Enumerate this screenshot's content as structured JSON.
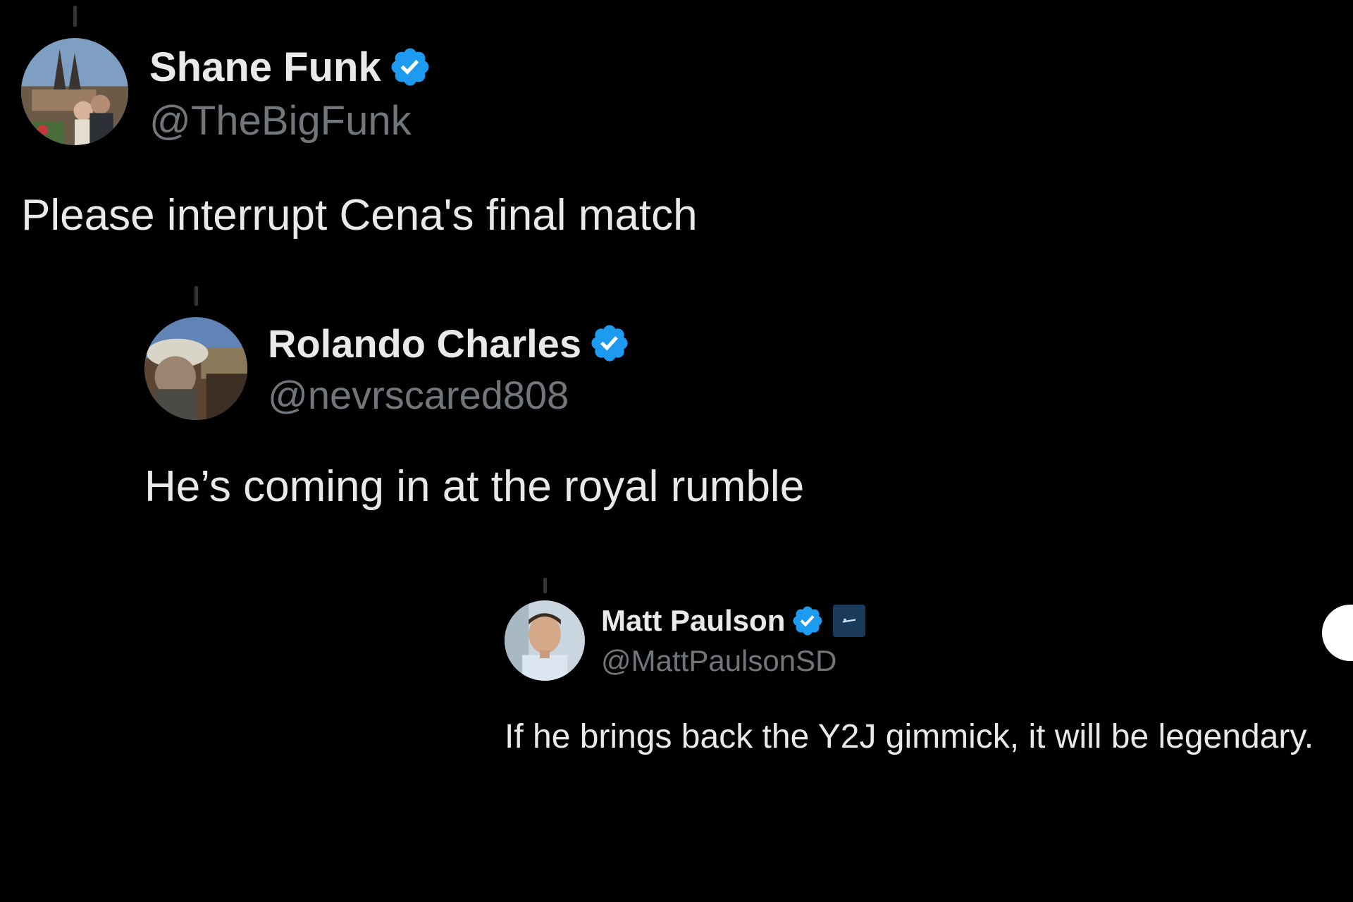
{
  "colors": {
    "background": "#000000",
    "text_primary": "#e7e9ea",
    "text_secondary": "#71767b",
    "verified_blue": "#1d9bf0",
    "thread_line": "#333639"
  },
  "tweets": [
    {
      "display_name": "Shane Funk",
      "handle": "@TheBigFunk",
      "verified_icon": "verified-badge-icon",
      "text": "Please interrupt Cena's final match"
    },
    {
      "display_name": "Rolando Charles",
      "handle": "@nevrscared808",
      "verified_icon": "verified-badge-icon",
      "text": "He’s coming in at the royal rumble"
    },
    {
      "display_name": "Matt Paulson",
      "handle": "@MattPaulsonSD",
      "verified_icon": "verified-badge-icon",
      "affiliate_icon": "affiliate-org-badge-icon",
      "text": "If he brings back the Y2J gimmick, it will be legendary."
    }
  ]
}
